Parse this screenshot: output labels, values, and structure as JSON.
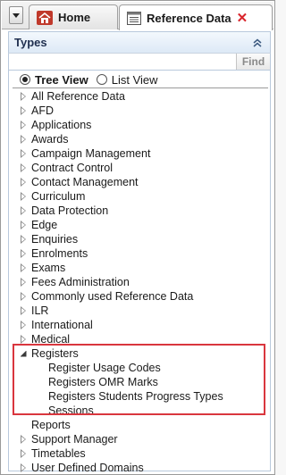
{
  "tabs": {
    "home_label": "Home",
    "reference_label": "Reference Data",
    "close_glyph": "✕"
  },
  "panel": {
    "title": "Types",
    "search": {
      "value": "",
      "placeholder": ""
    },
    "find_label": "Find"
  },
  "view": {
    "tree_label": "Tree View",
    "list_label": "List View",
    "selected": "tree"
  },
  "tree": {
    "items": [
      {
        "label": "All Reference Data",
        "expanded": false
      },
      {
        "label": "AFD",
        "expanded": false
      },
      {
        "label": "Applications",
        "expanded": false
      },
      {
        "label": "Awards",
        "expanded": false
      },
      {
        "label": "Campaign Management",
        "expanded": false
      },
      {
        "label": "Contract Control",
        "expanded": false
      },
      {
        "label": "Contact Management",
        "expanded": false
      },
      {
        "label": "Curriculum",
        "expanded": false
      },
      {
        "label": "Data Protection",
        "expanded": false
      },
      {
        "label": "Edge",
        "expanded": false
      },
      {
        "label": "Enquiries",
        "expanded": false
      },
      {
        "label": "Enrolments",
        "expanded": false
      },
      {
        "label": "Exams",
        "expanded": false
      },
      {
        "label": "Fees Administration",
        "expanded": false
      },
      {
        "label": "Commonly used Reference Data",
        "expanded": false
      },
      {
        "label": "ILR",
        "expanded": false
      },
      {
        "label": "International",
        "expanded": false
      },
      {
        "label": "Medical",
        "expanded": false
      },
      {
        "label": "Registers",
        "expanded": true
      },
      {
        "label": "Register Usage Codes",
        "child": true
      },
      {
        "label": "Registers OMR Marks",
        "child": true
      },
      {
        "label": "Registers Students Progress Types",
        "child": true
      },
      {
        "label": "Sessions",
        "child": true
      },
      {
        "label": "Reports",
        "leaf": true
      },
      {
        "label": "Support Manager",
        "expanded": false
      },
      {
        "label": "Timetables",
        "expanded": false
      },
      {
        "label": "User Defined Domains",
        "expanded": false
      }
    ]
  },
  "colors": {
    "highlight": "#d9363e",
    "close": "#d9242b",
    "panel_header": "#dde9f6"
  },
  "icons": {
    "dropdown": "caret-down-icon",
    "home": "home-icon",
    "reference": "reference-data-icon",
    "collapse": "double-chevron-up-icon"
  }
}
